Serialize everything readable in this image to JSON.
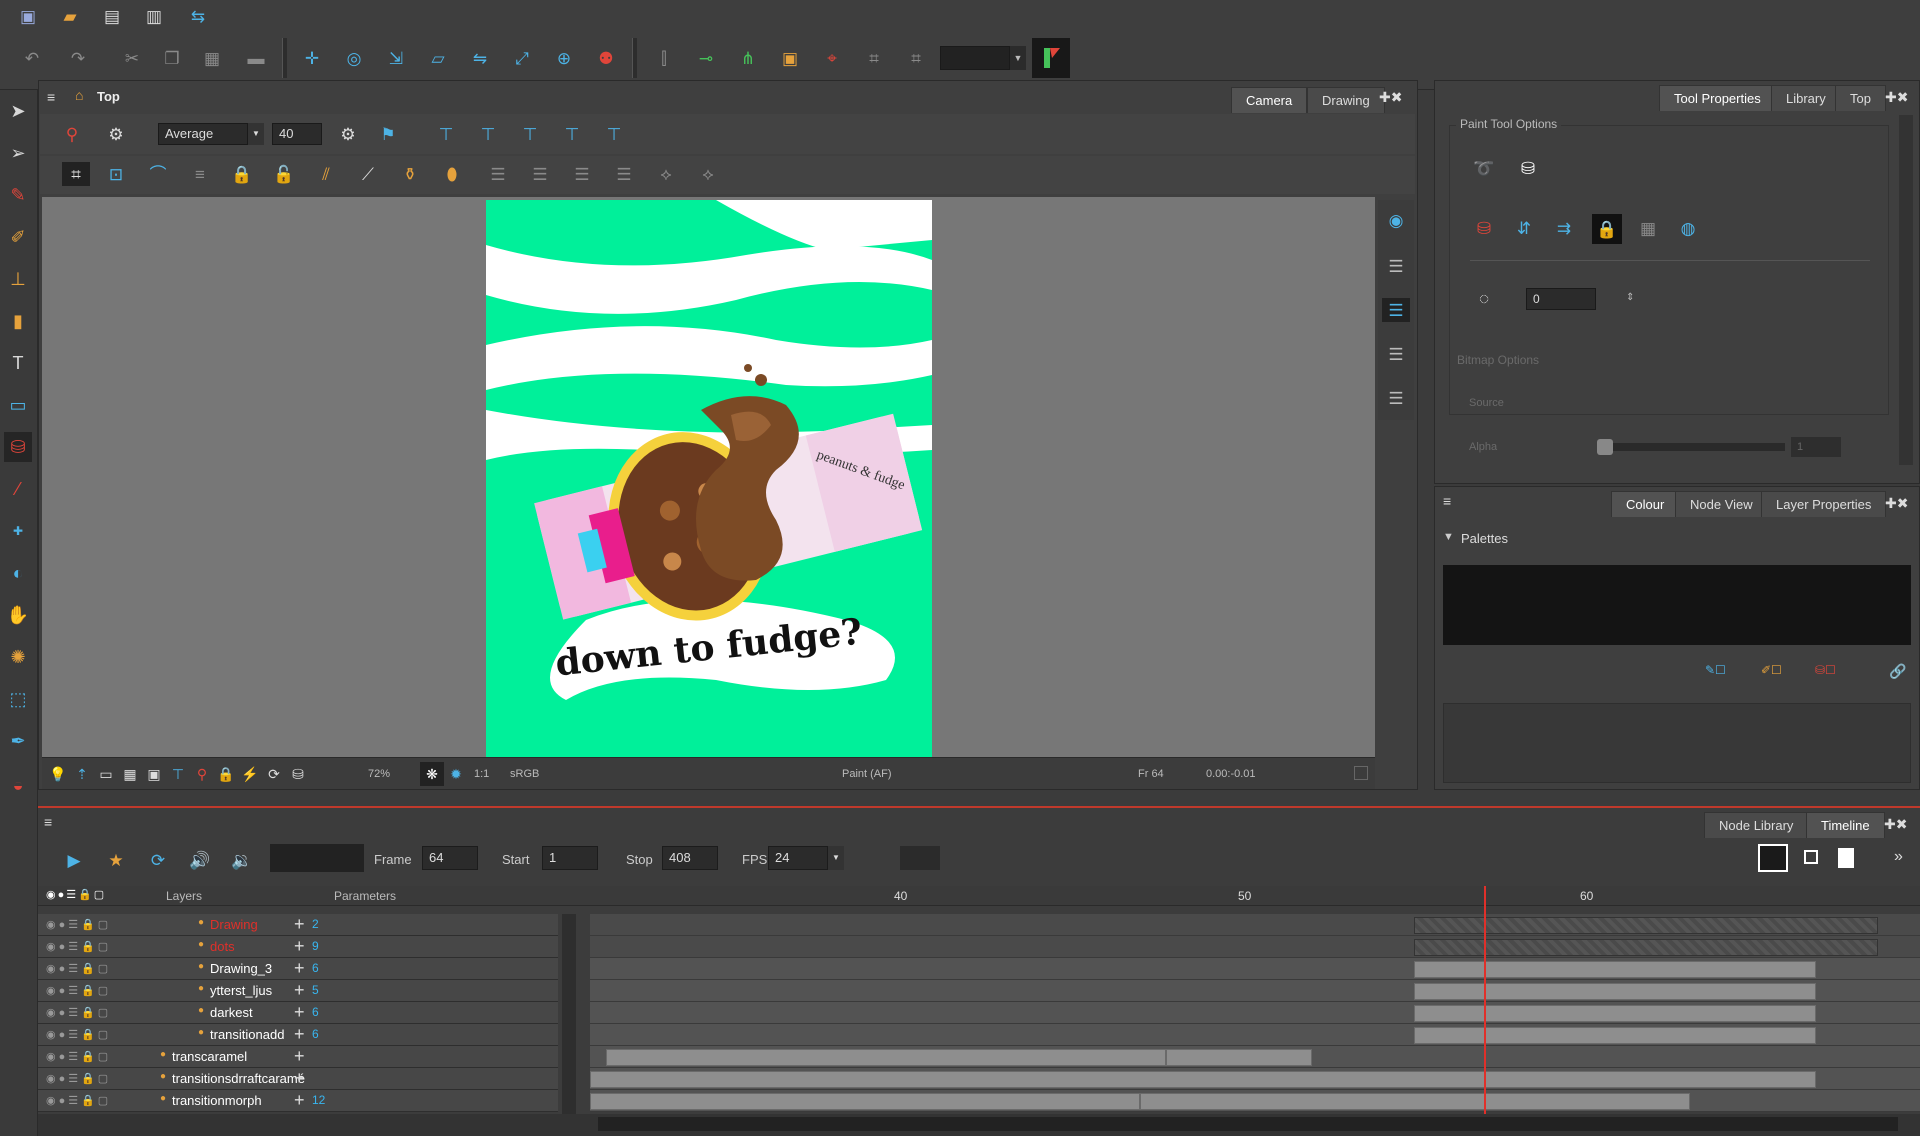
{
  "toolbar": {
    "icons_row1": [
      "new-scene-icon",
      "open-icon",
      "save-icon",
      "save-as-icon",
      "import-icon"
    ]
  },
  "camera_view": {
    "header": "Top",
    "tabs": [
      "Camera",
      "Drawing"
    ],
    "active_tab": "Camera",
    "onion_mode": "Average",
    "onion_value": "40",
    "artwork_text": "down to fudge?",
    "package_text": "peanuts & fudge",
    "colors": {
      "background": "#00f09a",
      "stage": "#777777"
    }
  },
  "status_bar": {
    "zoom": "72%",
    "ratio": "1:1",
    "color_space": "sRGB",
    "mode": "Paint (AF)",
    "frame": "Fr 64",
    "coords": "0.00:-0.01"
  },
  "tool_properties": {
    "tabs": [
      "Tool Properties",
      "Library",
      "Top"
    ],
    "active_tab": "Tool Properties",
    "section": "Paint Tool Options",
    "value": "0",
    "bitmap_section": "Bitmap Options",
    "source_label": "Source",
    "alpha_label": "Alpha",
    "alpha_value": "1"
  },
  "colour_panel": {
    "tabs": [
      "Colour",
      "Node View",
      "Layer Properties"
    ],
    "active_tab": "Colour",
    "palettes_label": "Palettes"
  },
  "timeline": {
    "tabs": [
      "Node Library",
      "Timeline"
    ],
    "active_tab": "Timeline",
    "frame_label": "Frame",
    "frame_value": "64",
    "start_label": "Start",
    "start_value": "1",
    "stop_label": "Stop",
    "stop_value": "408",
    "fps_label": "FPS",
    "fps_value": "24",
    "layers_header": "Layers",
    "parameters_header": "Parameters",
    "ruler": [
      "40",
      "50",
      "60"
    ],
    "current_frame_fraction": 0.672,
    "layers": [
      {
        "name": "Drawing",
        "param": "2",
        "color": "#e0302a"
      },
      {
        "name": "dots",
        "param": "9",
        "color": "#e0302a"
      },
      {
        "name": "Drawing_3",
        "param": "6",
        "color": "#ffffff"
      },
      {
        "name": "ytterst_ljus",
        "param": "5",
        "color": "#ffffff"
      },
      {
        "name": "darkest",
        "param": "6",
        "color": "#ffffff"
      },
      {
        "name": "transitionadd",
        "param": "6",
        "color": "#ffffff"
      },
      {
        "name": "transcaramel",
        "param": "",
        "color": "#ffffff"
      },
      {
        "name": "transitionsdrraftcaramé",
        "param": "",
        "color": "#ffffff"
      },
      {
        "name": "transitionmorph",
        "param": "12",
        "color": "#ffffff"
      }
    ]
  }
}
